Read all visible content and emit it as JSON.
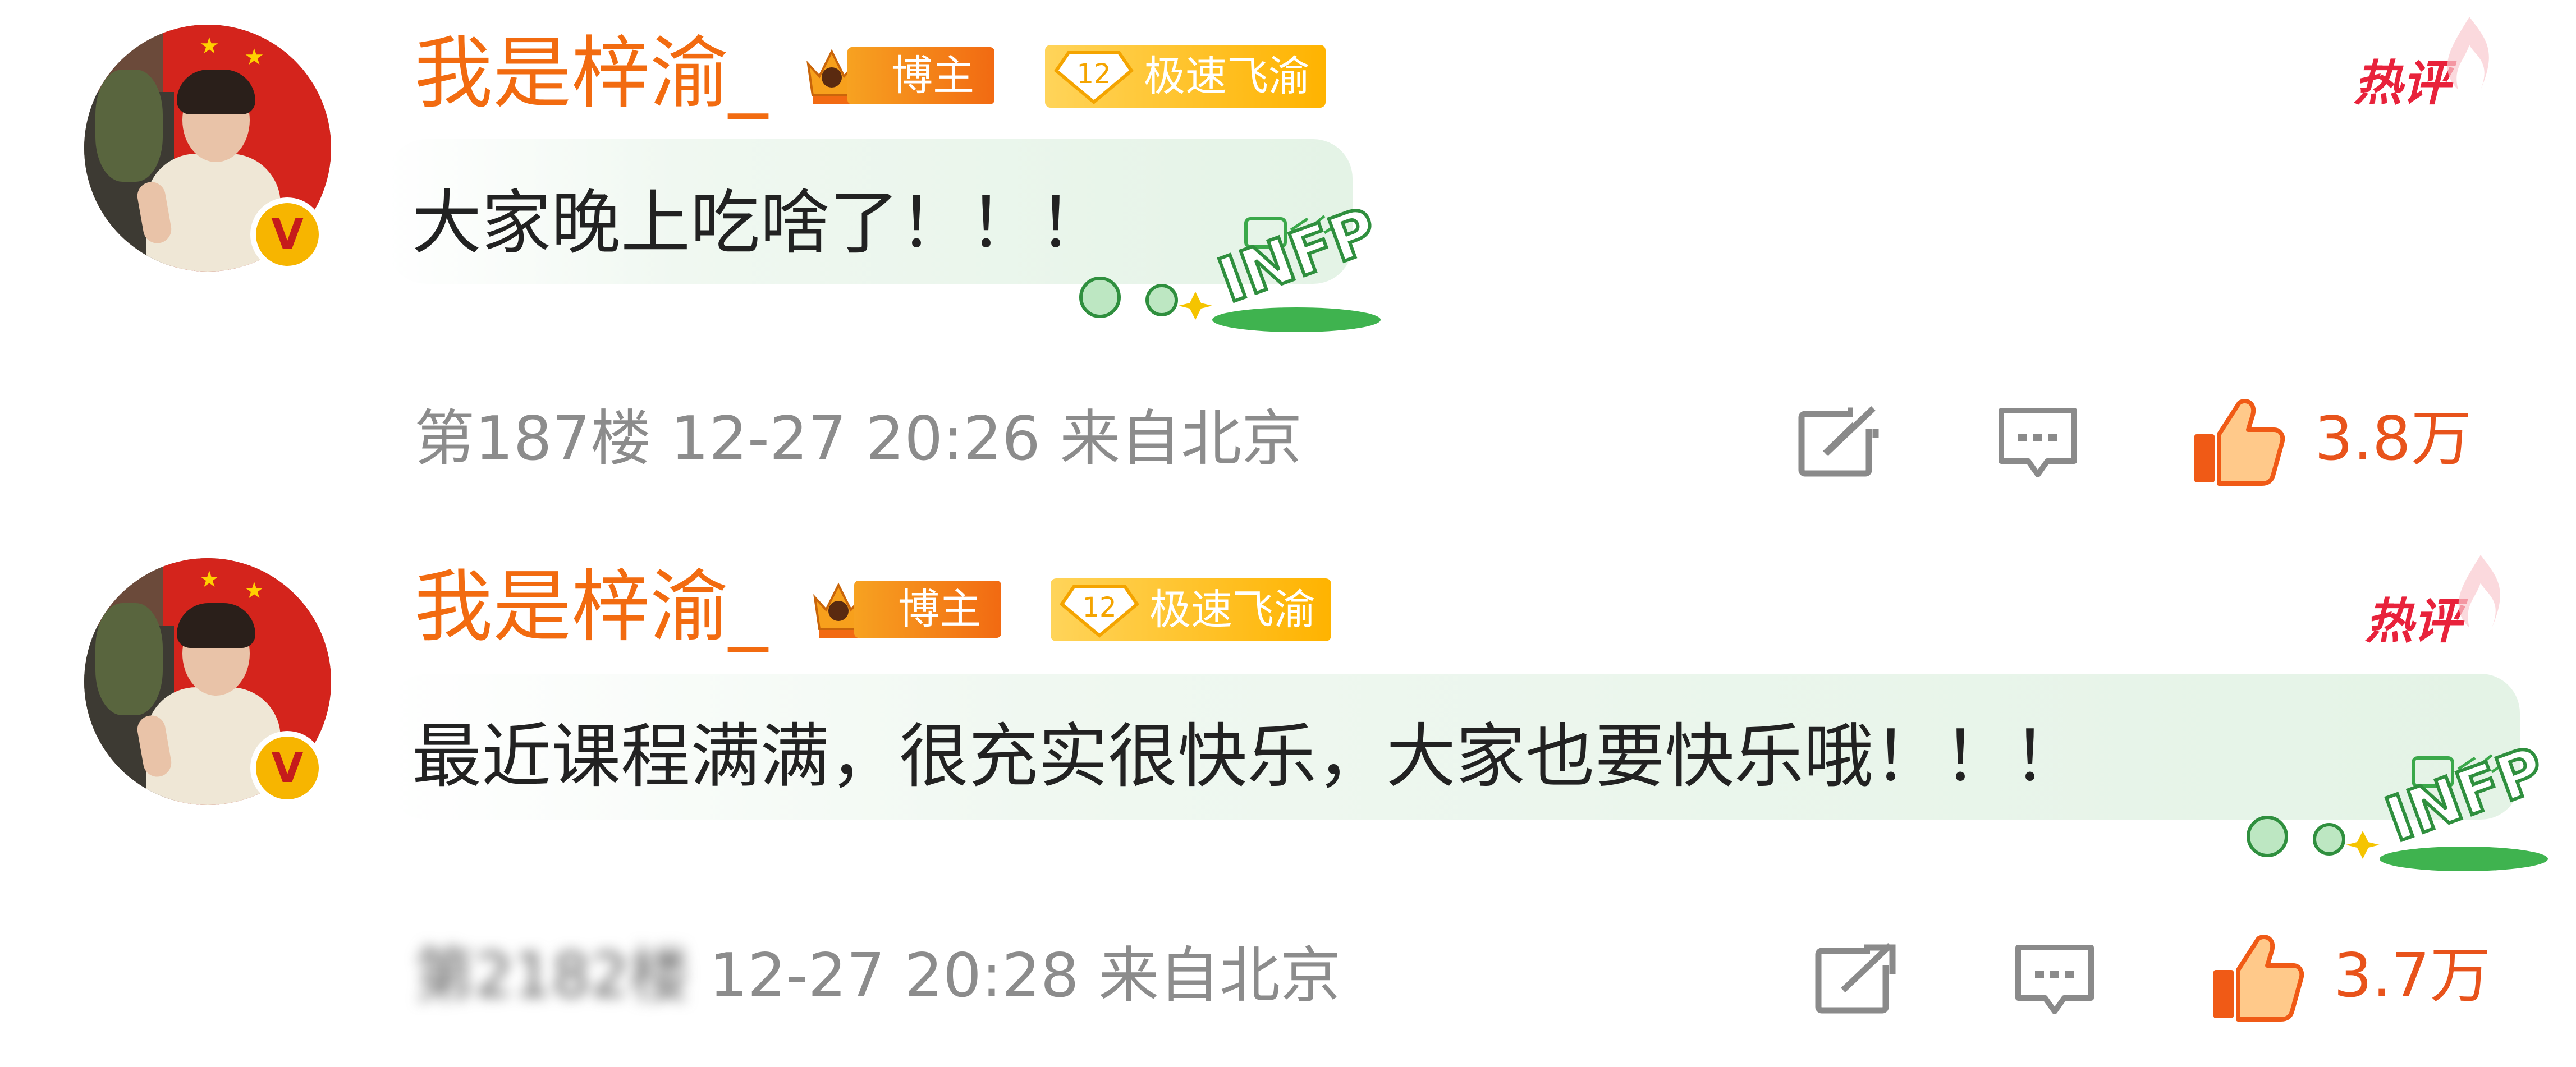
{
  "comments": [
    {
      "username": "我是梓渝_",
      "blogger_tag": "博主",
      "fan_level": "12",
      "fan_group": "极速飞渝",
      "hot_label": "热评",
      "text": "大家晚上吃啥了！！！",
      "mbti_deco": "INFP",
      "floor": "第187楼",
      "datetime": "12-27 20:26",
      "location": "来自北京",
      "likes": "3.8万"
    },
    {
      "username": "我是梓渝_",
      "blogger_tag": "博主",
      "fan_level": "12",
      "fan_group": "极速飞渝",
      "hot_label": "热评",
      "text": "最近课程满满，很充实很快乐，大家也要快乐哦！！！",
      "mbti_deco": "INFP",
      "floor": "第2182楼",
      "datetime": "12-27 20:28",
      "location": "来自北京",
      "likes": "3.7万"
    }
  ],
  "icons": {
    "verified": "verified-v-badge-icon",
    "crown": "crown-icon",
    "repost": "repost-icon",
    "reply": "comment-icon",
    "like": "thumbs-up-icon"
  },
  "colors": {
    "username": "#f26b10",
    "hot": "#e8223b",
    "like": "#e8531b",
    "meta": "#8c8c8c",
    "fan_tag": "#ffb300",
    "blogger_tag": "#f26a12"
  }
}
